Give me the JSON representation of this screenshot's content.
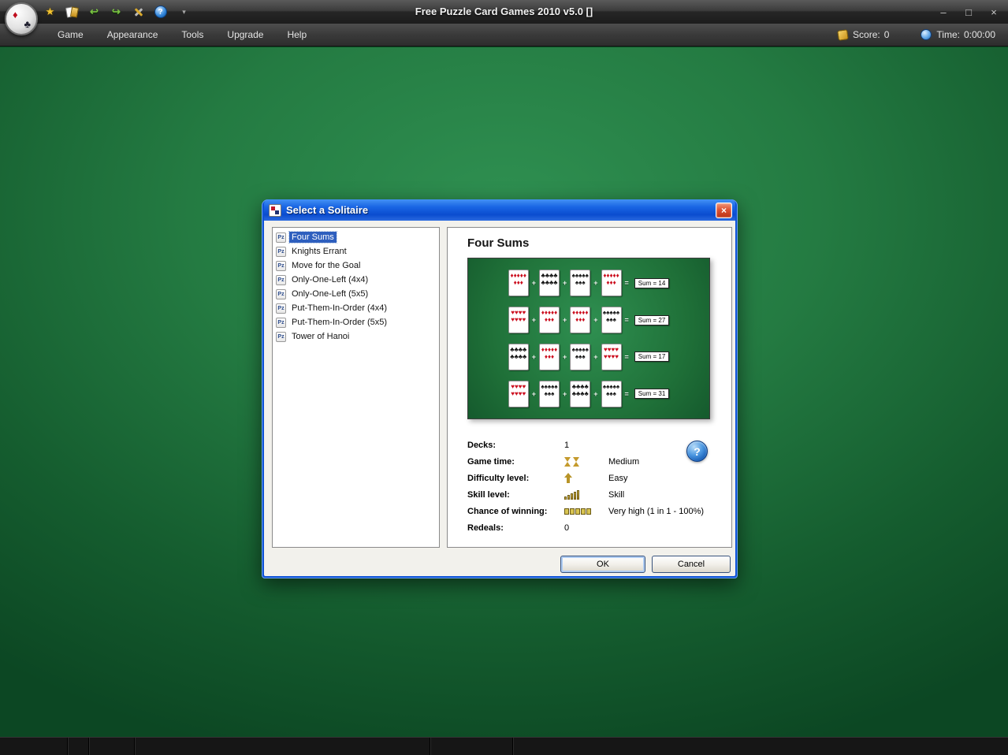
{
  "window": {
    "title": "Free Puzzle Card Games 2010 v5.0  []",
    "controls": {
      "minimize": "–",
      "maximize": "□",
      "close": "×"
    }
  },
  "toolbar": {
    "star_glyph": "★",
    "undo_glyph": "↩",
    "redo_glyph": "↪",
    "help_glyph": "?",
    "dropdown_glyph": "▾"
  },
  "menubar": {
    "items": [
      "Game",
      "Appearance",
      "Tools",
      "Upgrade",
      "Help"
    ],
    "score_label": "Score:",
    "score_value": "0",
    "time_label": "Time:",
    "time_value": "0:00:00"
  },
  "dialog": {
    "title": "Select a Solitaire",
    "close_glyph": "×",
    "games": [
      "Four Sums",
      "Knights Errant",
      "Move for the Goal",
      "Only-One-Left (4x4)",
      "Only-One-Left (5x5)",
      "Put-Them-In-Order (4x4)",
      "Put-Them-In-Order (5x5)",
      "Tower of Hanoi"
    ],
    "selected_index": 0,
    "list_icon_label": "Pz",
    "preview": {
      "title": "Four Sums",
      "rows": [
        {
          "cards": [
            {
              "suit": "♦",
              "color": "red"
            },
            {
              "suit": "♣",
              "color": "black"
            },
            {
              "suit": "♠",
              "color": "black"
            },
            {
              "suit": "♦",
              "color": "red"
            }
          ],
          "sum": "Sum = 14"
        },
        {
          "cards": [
            {
              "suit": "♥",
              "color": "red"
            },
            {
              "suit": "♦",
              "color": "red"
            },
            {
              "suit": "♦",
              "color": "red"
            },
            {
              "suit": "♠",
              "color": "black"
            }
          ],
          "sum": "Sum = 27"
        },
        {
          "cards": [
            {
              "suit": "♣",
              "color": "black"
            },
            {
              "suit": "♦",
              "color": "red"
            },
            {
              "suit": "♠",
              "color": "black"
            },
            {
              "suit": "♥",
              "color": "red"
            }
          ],
          "sum": "Sum = 17"
        },
        {
          "cards": [
            {
              "suit": "♥",
              "color": "red"
            },
            {
              "suit": "♠",
              "color": "black"
            },
            {
              "suit": "♣",
              "color": "black"
            },
            {
              "suit": "♠",
              "color": "black"
            }
          ],
          "sum": "Sum = 31"
        }
      ]
    },
    "stats": [
      {
        "label": "Decks:",
        "icon": "",
        "mid": "1",
        "value": ""
      },
      {
        "label": "Game time:",
        "icon": "hourglass",
        "mid": "",
        "value": "Medium"
      },
      {
        "label": "Difficulty level:",
        "icon": "arrow",
        "mid": "",
        "value": "Easy"
      },
      {
        "label": "Skill level:",
        "icon": "bars",
        "mid": "",
        "value": "Skill"
      },
      {
        "label": "Chance of winning:",
        "icon": "blocks",
        "mid": "",
        "value": "Very high (1 in 1  -  100%)"
      },
      {
        "label": "Redeals:",
        "icon": "",
        "mid": "0",
        "value": ""
      }
    ],
    "help_glyph": "?",
    "ok_label": "OK",
    "cancel_label": "Cancel"
  },
  "colors": {
    "felt_green": "#1f7a40",
    "dialog_blue": "#0e52d6",
    "selection_blue": "#2e5fbe",
    "gold": "#c49a2c"
  }
}
